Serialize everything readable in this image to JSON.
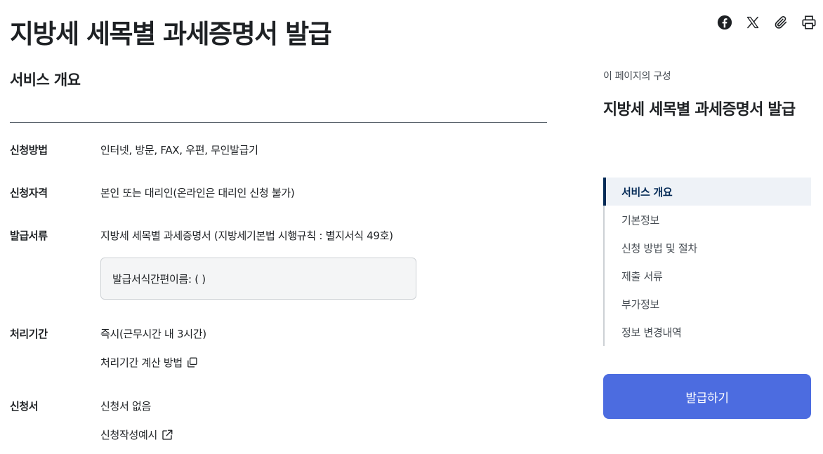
{
  "page": {
    "title": "지방세 세목별 과세증명서 발급"
  },
  "share": [
    {
      "icon": "facebook-icon"
    },
    {
      "icon": "x-twitter-icon"
    },
    {
      "icon": "attachment-icon"
    },
    {
      "icon": "print-icon"
    }
  ],
  "overview": {
    "title": "서비스 개요",
    "rows": {
      "method": {
        "label": "신청방법",
        "value": "인터넷, 방문, FAX, 우편, 무인발급기"
      },
      "eligibility": {
        "label": "신청자격",
        "value": "본인 또는 대리인(온라인은 대리인 신청 불가)"
      },
      "documents": {
        "label": "발급서류",
        "value": "지방세 세목별 과세증명서 (지방세기본법 시행규칙 : 별지서식 49호)",
        "form_box": "발급서식간편이름: ( )"
      },
      "period": {
        "label": "처리기간",
        "value": "즉시(근무시간 내 3시간)",
        "link": "처리기간 계산 방법"
      },
      "application": {
        "label": "신청서",
        "value": "신청서 없음",
        "link": "신청작성예시"
      }
    }
  },
  "toc": {
    "caption": "이 페이지의 구성",
    "title": "지방세 세목별 과세증명서 발급",
    "items": [
      {
        "label": "서비스 개요",
        "active": true
      },
      {
        "label": "기본정보",
        "active": false
      },
      {
        "label": "신청 방법 및 절차",
        "active": false
      },
      {
        "label": "제출 서류",
        "active": false
      },
      {
        "label": "부가정보",
        "active": false
      },
      {
        "label": "정보 변경내역",
        "active": false
      }
    ]
  },
  "action": {
    "issue_label": "발급하기",
    "color": "#4c6ce0"
  }
}
